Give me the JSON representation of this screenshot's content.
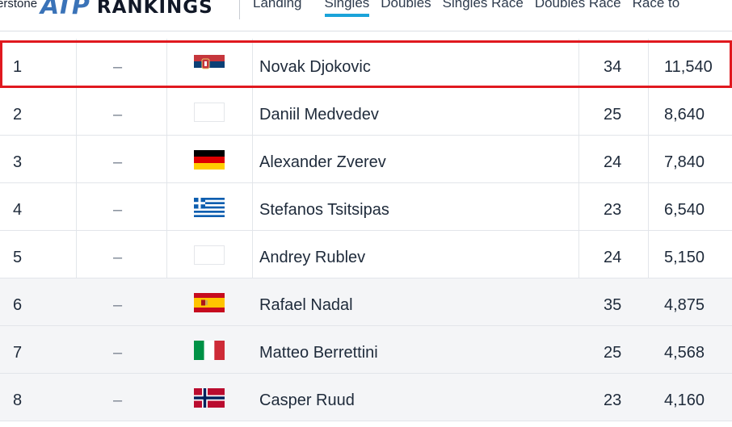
{
  "header": {
    "sponsor": "erstone",
    "logo_text": "ATP",
    "title": "RANKINGS"
  },
  "nav": {
    "tabs": [
      {
        "label": "Landing",
        "active": false
      },
      {
        "label": "Singles",
        "active": true
      },
      {
        "label": "Doubles",
        "active": false
      },
      {
        "label": "Singles Race",
        "active": false
      },
      {
        "label": "Doubles Race",
        "active": false
      },
      {
        "label": "Race to",
        "active": false
      }
    ]
  },
  "colors": {
    "accent": "#1aa3d9",
    "highlight_border": "#e0191f",
    "text": "#1e2a3a"
  },
  "rankings": [
    {
      "rank": "1",
      "move": "–",
      "flag": "serbia-flag",
      "name": "Novak Djokovic",
      "age": "34",
      "points": "11,540"
    },
    {
      "rank": "2",
      "move": "–",
      "flag": "blank-flag",
      "name": "Daniil Medvedev",
      "age": "25",
      "points": "8,640"
    },
    {
      "rank": "3",
      "move": "–",
      "flag": "germany-flag",
      "name": "Alexander Zverev",
      "age": "24",
      "points": "7,840"
    },
    {
      "rank": "4",
      "move": "–",
      "flag": "greece-flag",
      "name": "Stefanos Tsitsipas",
      "age": "23",
      "points": "6,540"
    },
    {
      "rank": "5",
      "move": "–",
      "flag": "blank-flag",
      "name": "Andrey Rublev",
      "age": "24",
      "points": "5,150"
    },
    {
      "rank": "6",
      "move": "–",
      "flag": "spain-flag",
      "name": "Rafael Nadal",
      "age": "35",
      "points": "4,875"
    },
    {
      "rank": "7",
      "move": "–",
      "flag": "italy-flag",
      "name": "Matteo Berrettini",
      "age": "25",
      "points": "4,568"
    },
    {
      "rank": "8",
      "move": "–",
      "flag": "norway-flag",
      "name": "Casper Ruud",
      "age": "23",
      "points": "4,160"
    }
  ]
}
